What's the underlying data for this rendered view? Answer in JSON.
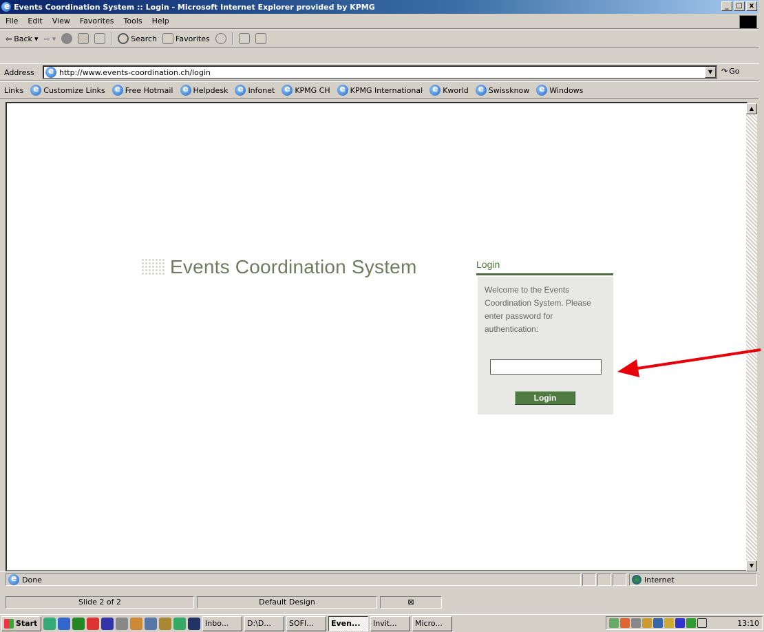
{
  "window": {
    "title": "Events Coordination System :: Login - Microsoft Internet Explorer provided by KPMG"
  },
  "menu": [
    "File",
    "Edit",
    "View",
    "Favorites",
    "Tools",
    "Help"
  ],
  "toolbar": {
    "back_label": "Back",
    "search_label": "Search",
    "favorites_label": "Favorites"
  },
  "address": {
    "label": "Address",
    "url": "http://www.events-coordination.ch/login",
    "go_label": "Go"
  },
  "links": {
    "label": "Links",
    "items": [
      "Customize Links",
      "Free Hotmail",
      "Helpdesk",
      "Infonet",
      "KPMG CH",
      "KPMG International",
      "Kworld",
      "Swissknow",
      "Windows"
    ]
  },
  "page": {
    "logo_text": "Events Coordination System",
    "login_heading": "Login",
    "welcome_text": "Welcome to the Events Coordination System. Please enter password for authentication:",
    "password_value": "",
    "login_button": "Login",
    "arrow_color": "#e8000b"
  },
  "status": {
    "text": "Done",
    "zone": "Internet"
  },
  "slidebar": {
    "slide": "Slide 2 of 2",
    "design": "Default Design"
  },
  "taskbar": {
    "start_label": "Start",
    "tasks": [
      "Inbo...",
      "D:\\D...",
      "SOFI...",
      "Even...",
      "Invit...",
      "Micro..."
    ],
    "clock": "13:10"
  }
}
